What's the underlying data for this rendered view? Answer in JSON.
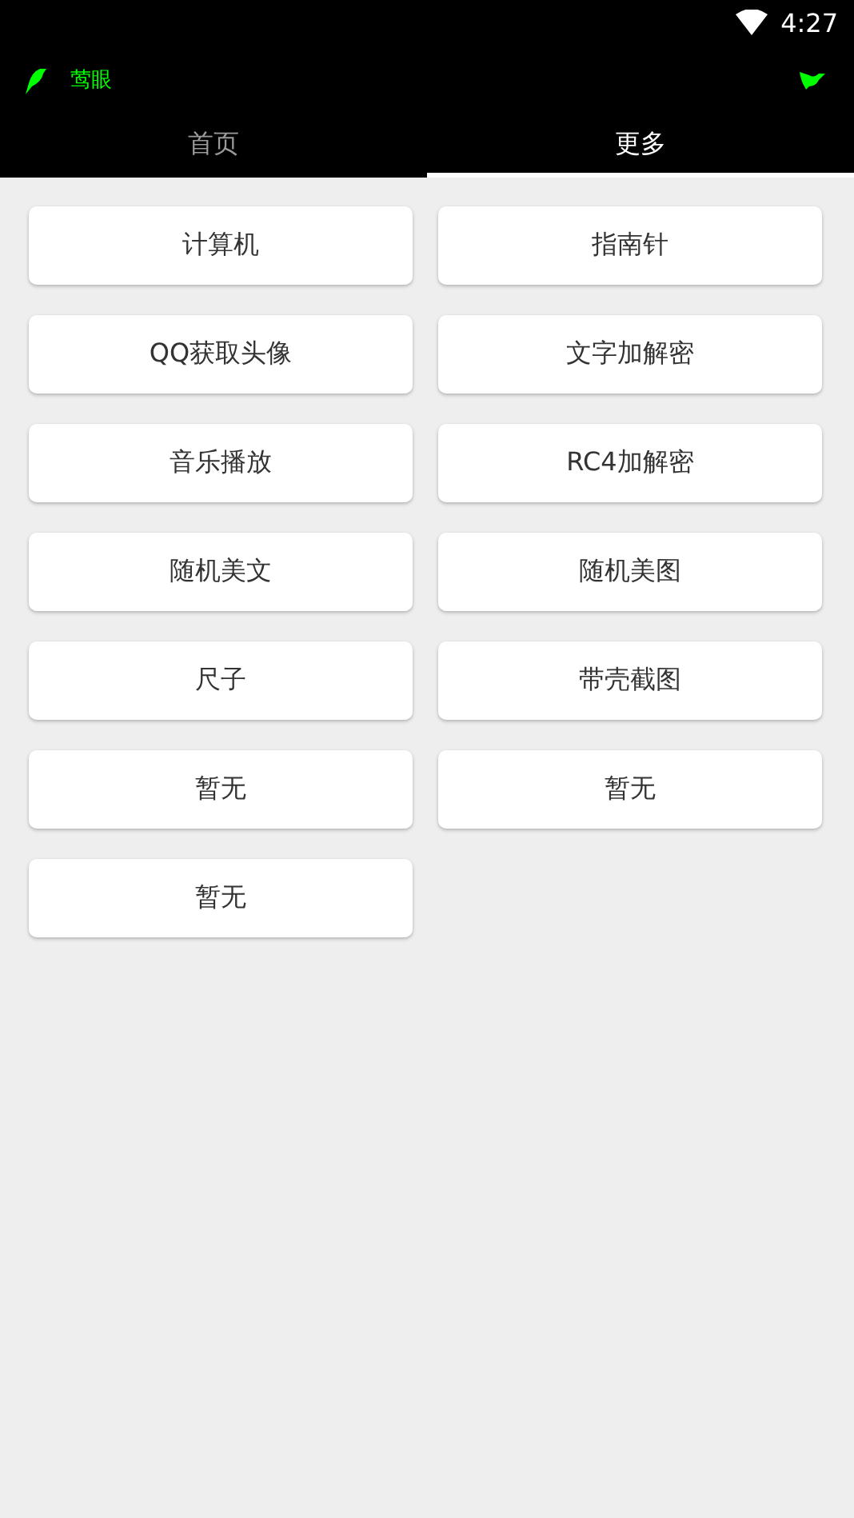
{
  "status_bar": {
    "time": "4:27"
  },
  "app_bar": {
    "title": "莺眼"
  },
  "tabs": [
    {
      "label": "首页",
      "selected": false
    },
    {
      "label": "更多",
      "selected": true
    }
  ],
  "tools": [
    "计算机",
    "指南针",
    "QQ获取头像",
    "文字加解密",
    "音乐播放",
    "RC4加解密",
    "随机美文",
    "随机美图",
    "尺子",
    "带壳截图",
    "暂无",
    "暂无",
    "暂无"
  ]
}
